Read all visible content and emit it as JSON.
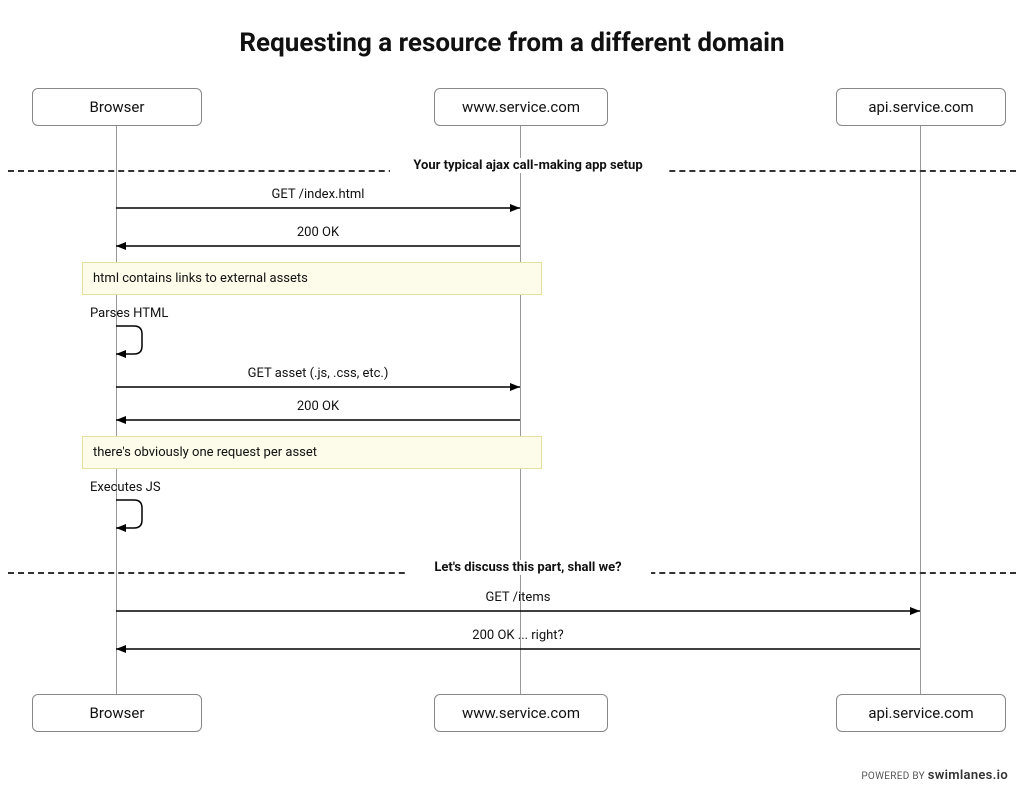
{
  "title": "Requesting a resource from a different domain",
  "participants": {
    "browser": "Browser",
    "www": "www.service.com",
    "api": "api.service.com"
  },
  "dividers": {
    "setup": "Your typical ajax call-making app setup",
    "discuss": "Let's discuss this part, shall we?"
  },
  "messages": {
    "m1": "GET /index.html",
    "m2": "200 OK",
    "m3": "GET asset (.js, .css, etc.)",
    "m4": "200 OK",
    "m5": "GET /items",
    "m6": "200 OK ... right?"
  },
  "notes": {
    "n1": "html contains links to external assets",
    "n2": "there's obviously one request per asset"
  },
  "self": {
    "s1": "Parses HTML",
    "s2": "Executes JS"
  },
  "footer": {
    "powered": "POWERED BY",
    "brand": "swimlanes.io"
  }
}
